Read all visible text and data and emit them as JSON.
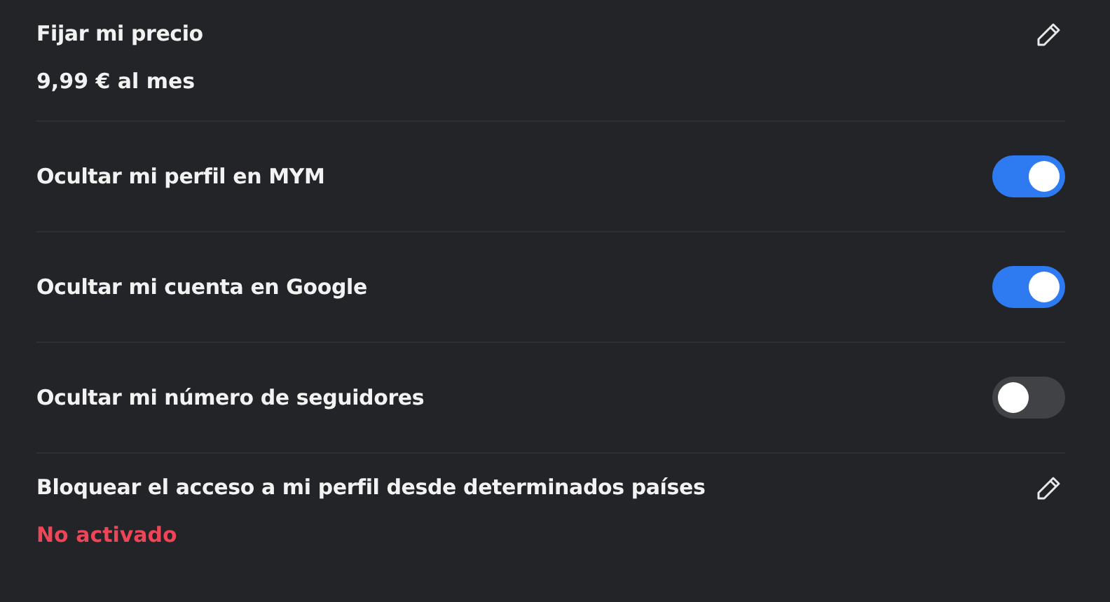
{
  "settings": [
    {
      "kind": "edit",
      "title": "Fijar mi precio",
      "value": "9,99 € al mes",
      "alert": false
    },
    {
      "kind": "toggle",
      "title": "Ocultar mi perfil en MYM",
      "on": true
    },
    {
      "kind": "toggle",
      "title": "Ocultar mi cuenta en Google",
      "on": true
    },
    {
      "kind": "toggle",
      "title": "Ocultar mi número de seguidores",
      "on": false
    },
    {
      "kind": "edit",
      "title": "Bloquear el acceso a mi perfil desde determinados países",
      "value": "No activado",
      "alert": true
    }
  ]
}
